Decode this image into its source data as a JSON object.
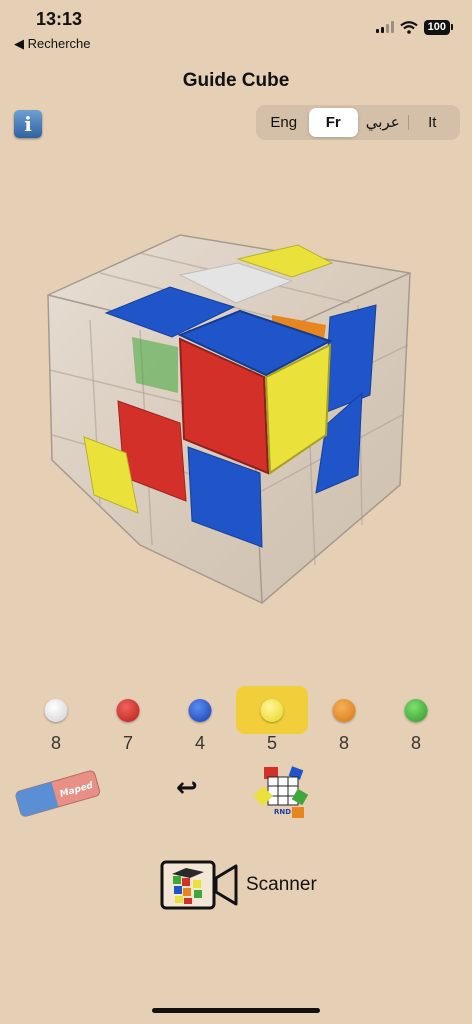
{
  "status_bar": {
    "time": "13:13",
    "back_label": "◀ Recherche",
    "battery": "100"
  },
  "header": {
    "title": "Guide Cube"
  },
  "info_button": {
    "label": "i"
  },
  "languages": [
    {
      "label": "Eng",
      "active": false
    },
    {
      "label": "Fr",
      "active": true
    },
    {
      "label": "عربي",
      "active": false
    },
    {
      "label": "It",
      "active": false
    }
  ],
  "colors": {
    "white": "#e4e4e4",
    "red": "#d4302a",
    "blue": "#1f55c8",
    "yellow": "#eae23a",
    "orange": "#e7861e",
    "green": "#3ea83a",
    "background": "#e6d0b5",
    "selected_highlight": "#f2cf3a"
  },
  "color_counts": [
    {
      "color": "white",
      "count": "8",
      "selected": false
    },
    {
      "color": "red",
      "count": "7",
      "selected": false
    },
    {
      "color": "blue",
      "count": "4",
      "selected": false
    },
    {
      "color": "yellow",
      "count": "5",
      "selected": true
    },
    {
      "color": "orange",
      "count": "8",
      "selected": false
    },
    {
      "color": "green",
      "count": "8",
      "selected": false
    }
  ],
  "tools": {
    "eraser_brand": "Maped",
    "undo_symbol": "↩",
    "random_label": "RND"
  },
  "scanner": {
    "label": "Scanner"
  }
}
